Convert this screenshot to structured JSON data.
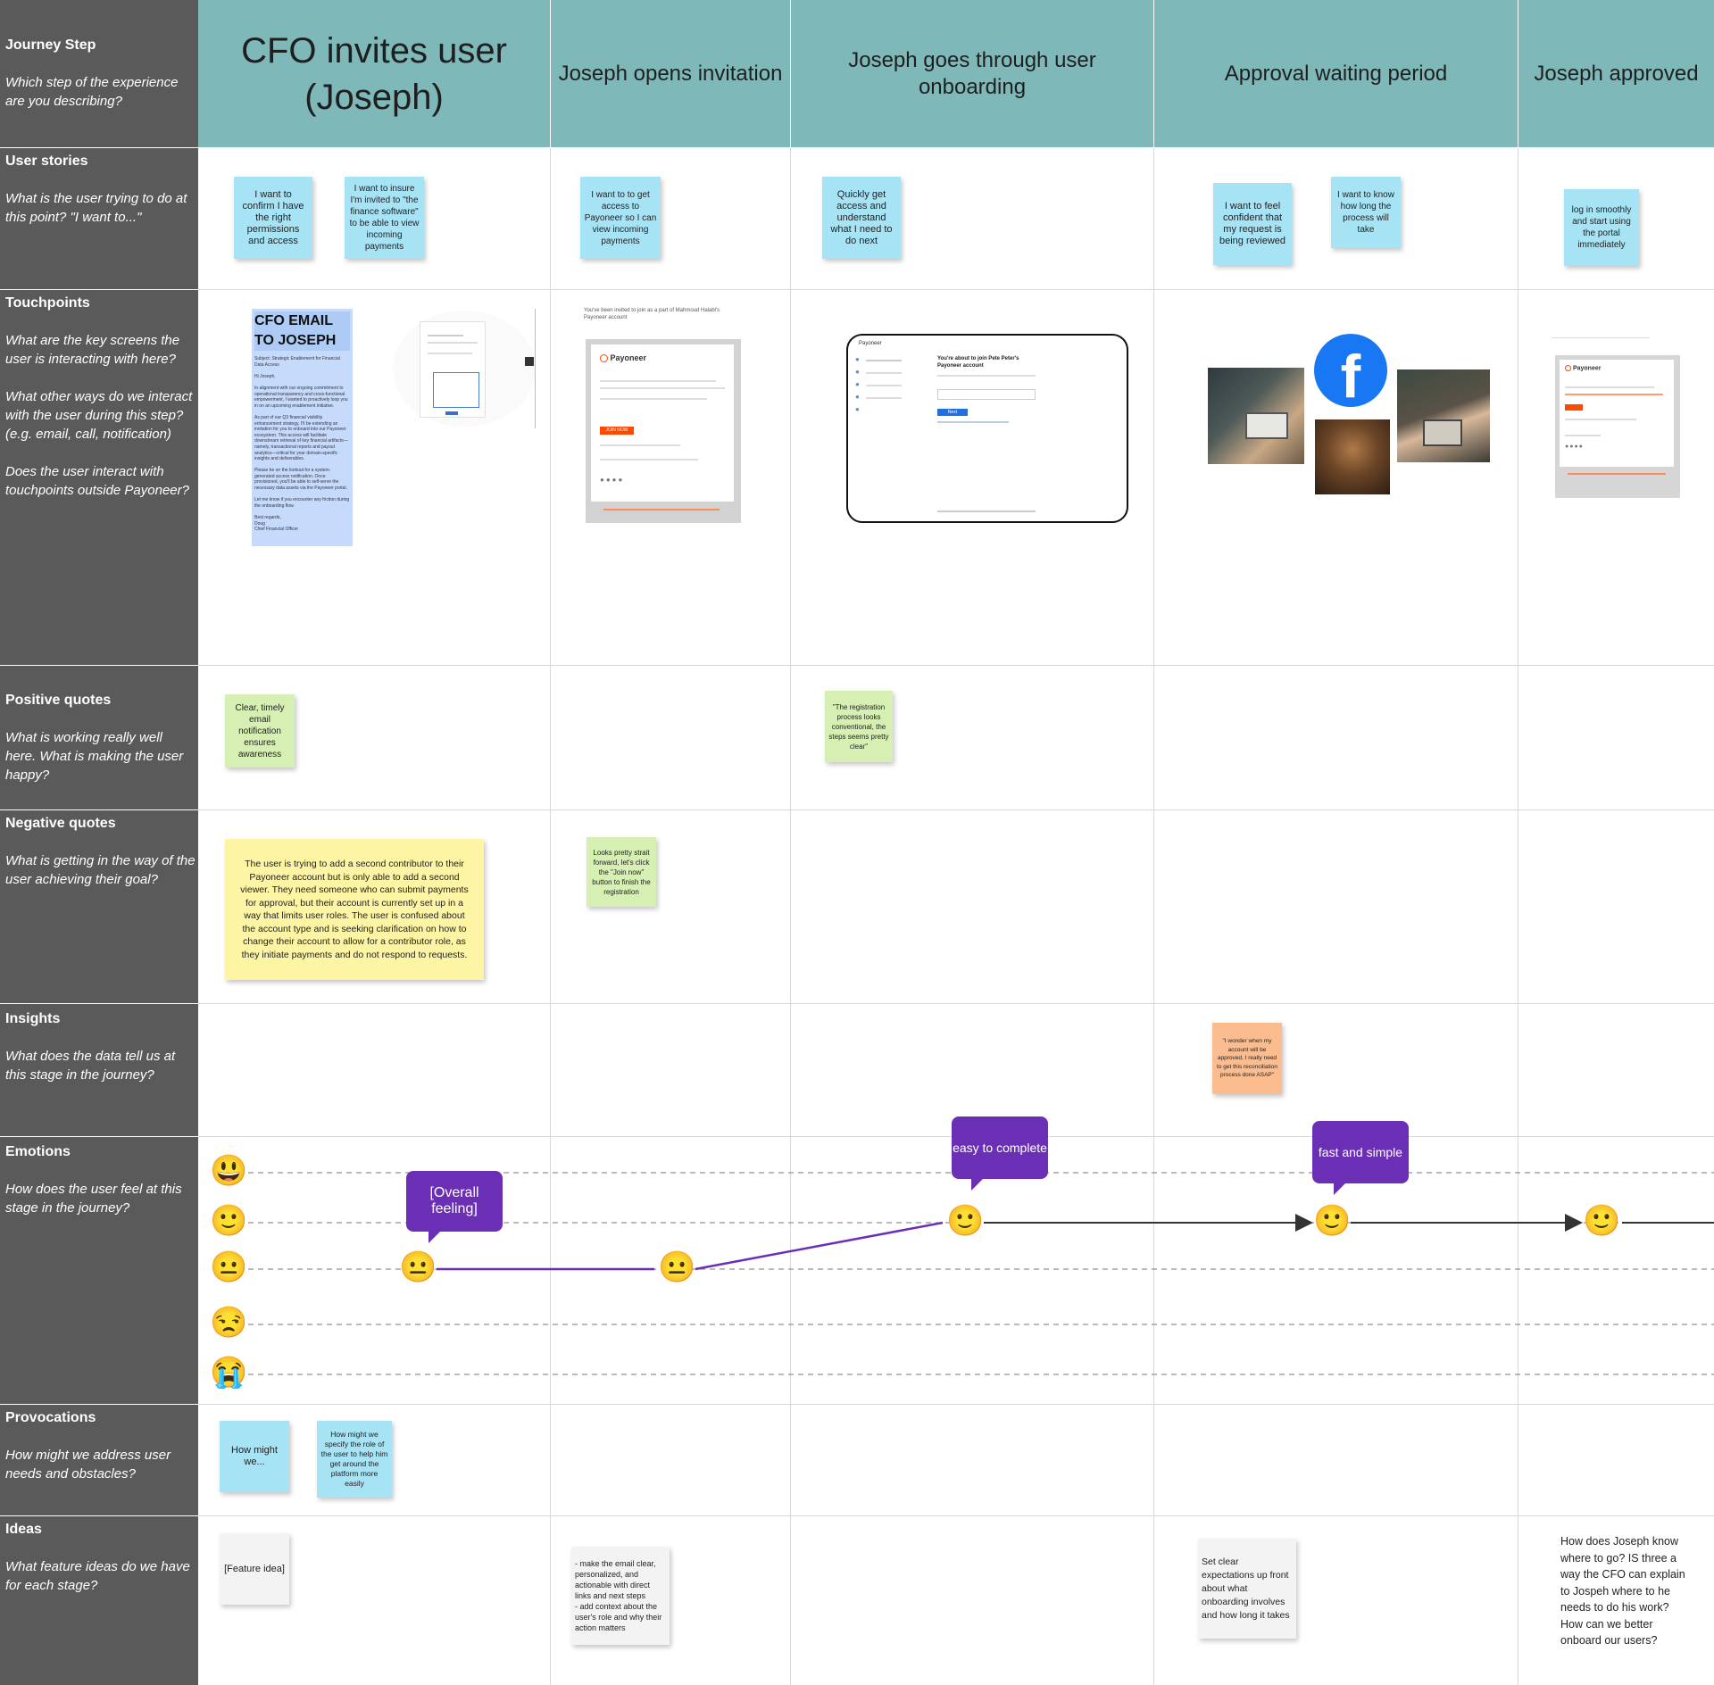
{
  "rows": [
    {
      "title": "Journey Step",
      "question": "Which step of the experience are you describing?"
    },
    {
      "title": "User stories",
      "question": "What is the user trying to do at this point? \"I want to...\""
    },
    {
      "title": "Touchpoints",
      "question": "What are the key screens the user is interacting with here?\n\nWhat other ways do we interact with the user during this step? (e.g. email, call, notification)\n\nDoes the user interact with touchpoints outside Payoneer?"
    },
    {
      "title": "Positive quotes",
      "question": "What is working really well here. What is making the user happy?"
    },
    {
      "title": "Negative quotes",
      "question": "What is getting in the way of the user achieving their goal?"
    },
    {
      "title": "Insights",
      "question": "What does the data tell us at this stage in the journey?"
    },
    {
      "title": "Emotions",
      "question": "How does the user feel at this stage in the journey?"
    },
    {
      "title": "Provocations",
      "question": "How might we address user needs and obstacles?"
    },
    {
      "title": "Ideas",
      "question": "What feature ideas do we have for each stage?"
    }
  ],
  "steps": [
    "CFO invites user (Joseph)",
    "Joseph opens invitation",
    "Joseph goes through user onboarding",
    "Approval waiting period",
    "Joseph approved"
  ],
  "user_stories": [
    "I want to confirm I have the right permissions and access",
    "I want to insure I'm invited to \"the finance software\" to be able to view incoming payments",
    "I want to  to get access to Payoneer so I can view incoming payments",
    "Quickly get access and understand what I need to do next",
    "I want to feel confident that my request is being reviewed",
    "I want to know how long the process will take",
    "log in smoothly and start using the portal immediately"
  ],
  "touchpoints": {
    "cfo_email_title": "CFO EMAIL TO JOSEPH",
    "cfo_email_body": "Subject: Strategic Enablement for Financial Data Access\n\nHi Joseph,\n\nIn alignment with our ongoing commitment to operational transparency and cross-functional empowerment, I wanted to proactively loop you in on an upcoming enablement initiative.\n\nAs part of our Q3 financial visibility enhancement strategy, I'll be extending an invitation for you to onboard into our Payoneer ecosystem. This access will facilitate downstream retrieval of key financial artifacts—namely, transactional reports and payout analytics—critical for your domain-specific insights and deliverables.\n\nPlease be on the lookout for a system-generated access notification. Once provisioned, you'll be able to self-serve the necessary data assets via the Payoneer portal.\n\nLet me know if you encounter any friction during the onboarding flow.\n\nBest regards,\nDoug\nChief Financial Officer",
    "invite_header": "You've been invited to join as a part of Mahmoud Halabi's Payoneer account",
    "payoneer_brand": "Payoneer",
    "join_button": "JOIN NOW",
    "onboarding_heading": "You're about to join Pete Peter's Payoneer account",
    "next_button": "Next",
    "facebook_letter": "f"
  },
  "positive_quotes": [
    "Clear, timely email notification ensures awareness",
    "\"The registration process looks conventional, the steps seems pretty clear\""
  ],
  "negative_quotes": {
    "main": "The user is trying to add a second contributor to their Payoneer account but is only able to add a second viewer. They need someone who can submit payments for approval, but their account is currently set up in a way that limits user roles. The user is confused about the account type and is seeking clarification on how to change their account to allow for a contributor role, as they initiate payments and do not respond to requests.",
    "second": "Looks pretty strait forward, let's click the \"Join now\" button to finish the registration"
  },
  "insights": [
    "\"I wonder when my account will be approved, I really need to get this reconciliation process done ASAP\""
  ],
  "emotions": {
    "levels": [
      "very-happy",
      "happy",
      "neutral",
      "unhappy",
      "crying"
    ],
    "level_glyphs": [
      "😃",
      "🙂",
      "😐",
      "😒",
      "😭"
    ],
    "bubbles": [
      "[Overall feeling]",
      "easy to complete",
      "fast and simple"
    ],
    "points": [
      {
        "step": 0,
        "level": "neutral"
      },
      {
        "step": 1,
        "level": "neutral"
      },
      {
        "step": 2,
        "level": "happy"
      },
      {
        "step": 3,
        "level": "happy"
      },
      {
        "step": 4,
        "level": "happy"
      }
    ]
  },
  "provocations": [
    "How might we...",
    "How might we specify the role of the user to help him get around the platform more easily"
  ],
  "ideas": [
    "[Feature idea]",
    "- make the email clear, personalized, and actionable with direct links and next steps\n- add context about the user's role and why their action matters",
    "Set clear expectations up front about what onboarding involves and how long it takes",
    "How does Joseph know where to go? IS three a way the CFO can explain to Jospeh where to he needs to do his work? How can we better onboard our users?"
  ],
  "colors": {
    "header_teal": "#7fb8b9",
    "label_gray": "#5a5a5a",
    "sticky_blue": "#a6e3f5",
    "sticky_green": "#d6efb2",
    "sticky_yellow": "#fdf4a4",
    "sticky_orange": "#fbbd8f",
    "bubble_purple": "#6b2fb5",
    "payoneer_orange": "#ff4800"
  }
}
